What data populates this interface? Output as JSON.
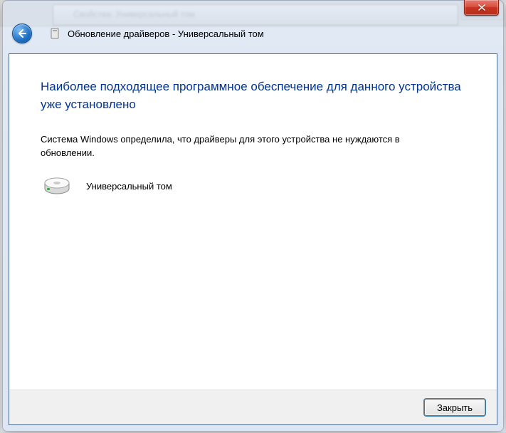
{
  "background": {
    "blurred_title": "Свойства: Универсальный том"
  },
  "dialog": {
    "title": "Обновление драйверов - Универсальный том",
    "heading": "Наиболее подходящее программное обеспечение для данного устройства уже установлено",
    "description": "Система Windows определила, что драйверы для этого устройства не нуждаются в обновлении.",
    "device_name": "Универсальный том",
    "close_button": "Закрыть"
  }
}
